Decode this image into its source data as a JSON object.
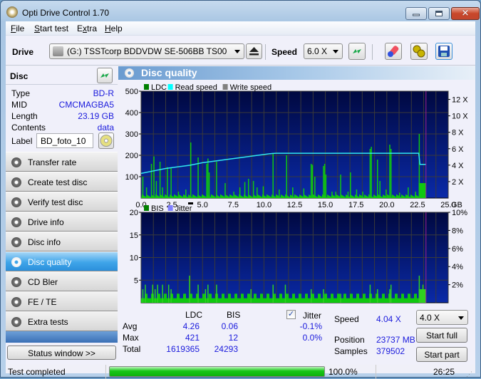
{
  "window": {
    "title": "Opti Drive Control 1.70"
  },
  "menu": [
    {
      "label": "File",
      "accel": "F",
      "rest": "ile"
    },
    {
      "label": "Start test",
      "accel": "S",
      "rest": "tart test"
    },
    {
      "label": "Extra",
      "accel": "",
      "pre": "E",
      "accel2": "x",
      "rest": "tra"
    },
    {
      "label": "Help",
      "accel": "H",
      "rest": "elp"
    }
  ],
  "toolbar": {
    "drive_label": "Drive",
    "drive_value": "(G:)  TSSTcorp BDDVDW SE-506BB TS00",
    "speed_label": "Speed",
    "speed_value": "6.0 X"
  },
  "disc": {
    "header": "Disc",
    "rows": [
      {
        "key": "Type",
        "value": "BD-R"
      },
      {
        "key": "MID",
        "value": "CMCMAGBA5"
      },
      {
        "key": "Length",
        "value": "23.19 GB"
      },
      {
        "key": "Contents",
        "value": "data"
      }
    ],
    "label_key": "Label",
    "label_value": "BD_foto_10"
  },
  "nav": [
    {
      "label": "Transfer rate",
      "active": false
    },
    {
      "label": "Create test disc",
      "active": false
    },
    {
      "label": "Verify test disc",
      "active": false
    },
    {
      "label": "Drive info",
      "active": false
    },
    {
      "label": "Disc info",
      "active": false
    },
    {
      "label": "Disc quality",
      "active": true
    },
    {
      "label": "CD Bler",
      "active": false
    },
    {
      "label": "FE / TE",
      "active": false
    },
    {
      "label": "Extra tests",
      "active": false
    }
  ],
  "status_window_button": "Status window >>",
  "panel": {
    "title": "Disc quality"
  },
  "chart_data": [
    {
      "type": "bar",
      "title": "LDC",
      "legend": [
        "LDC",
        "Read speed",
        "Write speed"
      ],
      "legend_colors": [
        "#008000",
        "#00ffff",
        "#808080"
      ],
      "xlabel": "GB",
      "xlim": [
        0,
        25
      ],
      "x_ticks": [
        "0.0",
        "2.5",
        "5.0",
        "7.5",
        "10.0",
        "12.5",
        "15.0",
        "17.5",
        "20.0",
        "22.5",
        "25.0"
      ],
      "ylim": [
        0,
        500
      ],
      "y_ticks": [
        "100",
        "200",
        "300",
        "400",
        "500"
      ],
      "y2lim": [
        0,
        13
      ],
      "y2_ticks": [
        "2 X",
        "4 X",
        "6 X",
        "8 X",
        "10 X",
        "12 X"
      ],
      "end_marker_gb": 23.19,
      "ldc_spikes": [
        [
          0.1,
          100
        ],
        [
          0.4,
          50
        ],
        [
          0.8,
          160
        ],
        [
          1.0,
          195
        ],
        [
          1.2,
          80
        ],
        [
          1.5,
          170
        ],
        [
          1.7,
          50
        ],
        [
          2.1,
          145
        ],
        [
          2.4,
          140
        ],
        [
          3.0,
          30
        ],
        [
          3.6,
          40
        ],
        [
          4.0,
          260
        ],
        [
          4.6,
          190
        ],
        [
          5.3,
          160
        ],
        [
          5.4,
          185
        ],
        [
          5.5,
          120
        ],
        [
          6.1,
          170
        ],
        [
          6.8,
          70
        ],
        [
          7.5,
          30
        ],
        [
          8.0,
          50
        ],
        [
          8.4,
          75
        ],
        [
          8.7,
          90
        ],
        [
          9.1,
          80
        ],
        [
          9.4,
          50
        ],
        [
          9.9,
          55
        ],
        [
          10.7,
          210
        ],
        [
          11.2,
          40
        ],
        [
          11.8,
          200
        ],
        [
          12.3,
          50
        ],
        [
          13.2,
          45
        ],
        [
          13.8,
          160
        ],
        [
          13.9,
          155
        ],
        [
          14.1,
          100
        ],
        [
          14.8,
          150
        ],
        [
          14.9,
          160
        ],
        [
          15.0,
          110
        ],
        [
          15.5,
          30
        ],
        [
          15.8,
          30
        ],
        [
          16.2,
          110
        ],
        [
          16.8,
          30
        ],
        [
          17.0,
          120
        ],
        [
          17.5,
          40
        ],
        [
          18.0,
          30
        ],
        [
          18.6,
          230
        ],
        [
          18.7,
          240
        ],
        [
          19.2,
          180
        ],
        [
          19.4,
          80
        ],
        [
          19.9,
          40
        ],
        [
          20.2,
          250
        ],
        [
          20.3,
          230
        ],
        [
          21.0,
          25
        ],
        [
          21.7,
          50
        ],
        [
          22.3,
          30
        ],
        [
          22.6,
          300
        ]
      ],
      "ldc_tail": {
        "from_gb": 22.6,
        "to_gb": 23.19,
        "level": 70
      },
      "read_speed": [
        [
          0.0,
          3.0
        ],
        [
          1.0,
          3.3
        ],
        [
          2.0,
          3.6
        ],
        [
          3.0,
          3.8
        ],
        [
          4.0,
          4.0
        ],
        [
          5.0,
          4.3
        ],
        [
          6.0,
          4.5
        ],
        [
          7.0,
          4.7
        ],
        [
          8.0,
          4.9
        ],
        [
          9.0,
          5.1
        ],
        [
          10.0,
          5.3
        ],
        [
          10.5,
          5.4
        ],
        [
          11.0,
          5.45
        ],
        [
          22.6,
          5.45
        ],
        [
          22.7,
          4.1
        ],
        [
          23.19,
          4.1
        ]
      ]
    },
    {
      "type": "bar",
      "title": "BIS",
      "legend": [
        "BIS",
        "Jitter"
      ],
      "legend_colors": [
        "#008000",
        "#8080ff"
      ],
      "xlabel": "GB",
      "xlim": [
        0,
        25
      ],
      "x_ticks": [
        "0.0",
        "2.5",
        "5.0",
        "7.5",
        "10.0",
        "12.5",
        "15.0",
        "17.5",
        "20.0",
        "22.5",
        "25.0"
      ],
      "ylim": [
        0,
        20
      ],
      "y_ticks": [
        "5",
        "10",
        "15",
        "20"
      ],
      "y2lim": [
        0,
        10
      ],
      "y2_ticks": [
        "2%",
        "4%",
        "6%",
        "8%",
        "10%"
      ],
      "end_marker_gb": 23.19,
      "bis_spikes": [
        [
          0.1,
          3
        ],
        [
          0.3,
          4
        ],
        [
          0.9,
          4
        ],
        [
          1.1,
          3
        ],
        [
          1.3,
          4
        ],
        [
          1.7,
          4
        ],
        [
          2.2,
          4
        ],
        [
          2.4,
          3
        ],
        [
          3.9,
          6
        ],
        [
          4.6,
          4
        ],
        [
          5.2,
          3
        ],
        [
          5.4,
          4
        ],
        [
          6.1,
          4
        ],
        [
          8.9,
          3
        ],
        [
          10.7,
          4
        ],
        [
          11.7,
          4
        ],
        [
          13.8,
          3
        ],
        [
          14.8,
          3
        ],
        [
          16.2,
          2
        ],
        [
          18.6,
          4
        ],
        [
          19.2,
          3
        ],
        [
          20.3,
          4
        ],
        [
          20.2,
          3
        ],
        [
          22.6,
          6
        ],
        [
          22.9,
          4
        ]
      ],
      "bis_tail": {
        "from_gb": 22.6,
        "to_gb": 23.19,
        "level": 3
      }
    }
  ],
  "stats": {
    "col_ldc": "LDC",
    "col_bis": "BIS",
    "rows": [
      {
        "label": "Avg",
        "ldc": "4.26",
        "bis": "0.06",
        "jitter": "-0.1%"
      },
      {
        "label": "Max",
        "ldc": "421",
        "bis": "12",
        "jitter": "0.0%"
      },
      {
        "label": "Total",
        "ldc": "1619365",
        "bis": "24293"
      }
    ],
    "jitter_label": "Jitter",
    "jitter_checked": true,
    "speed_label": "Speed",
    "speed_value": "4.04 X",
    "position_label": "Position",
    "position_value": "23737 MB",
    "samples_label": "Samples",
    "samples_value": "379502",
    "speed_select": "4.0 X",
    "start_full": "Start full",
    "start_part": "Start part"
  },
  "statusbar": {
    "text": "Test completed",
    "progress": 1.0,
    "progress_text": "100.0%",
    "time": "26:25"
  }
}
